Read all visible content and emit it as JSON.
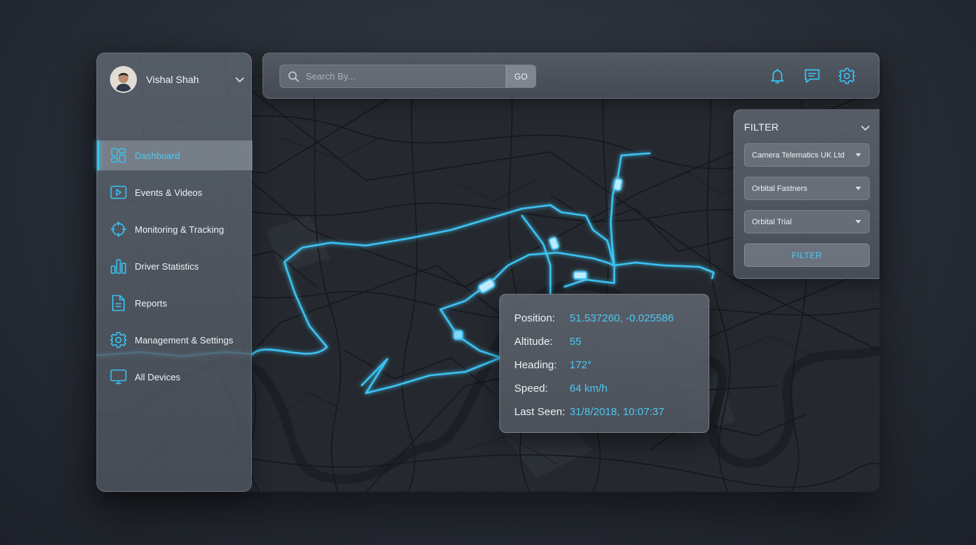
{
  "user": {
    "name": "Vishal Shah"
  },
  "nav": {
    "items": [
      {
        "label": "Dashboard",
        "icon": "dashboard-icon",
        "active": true
      },
      {
        "label": "Events & Videos",
        "icon": "video-icon"
      },
      {
        "label": "Monitoring & Tracking",
        "icon": "crosshair-icon"
      },
      {
        "label": "Driver Statistics",
        "icon": "bar-chart-icon"
      },
      {
        "label": "Reports",
        "icon": "document-icon"
      },
      {
        "label": "Management & Settings",
        "icon": "gear-icon"
      },
      {
        "label": "All Devices",
        "icon": "monitor-icon"
      }
    ]
  },
  "search": {
    "placeholder": "Search By...",
    "value": "",
    "go_label": "GO"
  },
  "toolbar_icons": [
    "bell-icon",
    "chat-icon",
    "settings-icon"
  ],
  "filter": {
    "title": "FILTER",
    "selects": [
      "Camera Telematics UK Ltd",
      "Orbital Fastners",
      "Orbital Trial"
    ],
    "button_label": "FILTER"
  },
  "vehicle_info": {
    "position": {
      "label": "Position:",
      "value": "51.537260, -0.025586"
    },
    "altitude": {
      "label": "Altitude:",
      "value": "55"
    },
    "heading": {
      "label": "Heading:",
      "value": "172°"
    },
    "speed": {
      "label": "Speed:",
      "value": "64 km/h"
    },
    "last_seen": {
      "label": "Last Seen:",
      "value": "31/8/2018, 10:07:37"
    }
  },
  "colors": {
    "accent": "#37c3f0",
    "route": "#3cc2f2",
    "map_bg": "#25292f"
  }
}
